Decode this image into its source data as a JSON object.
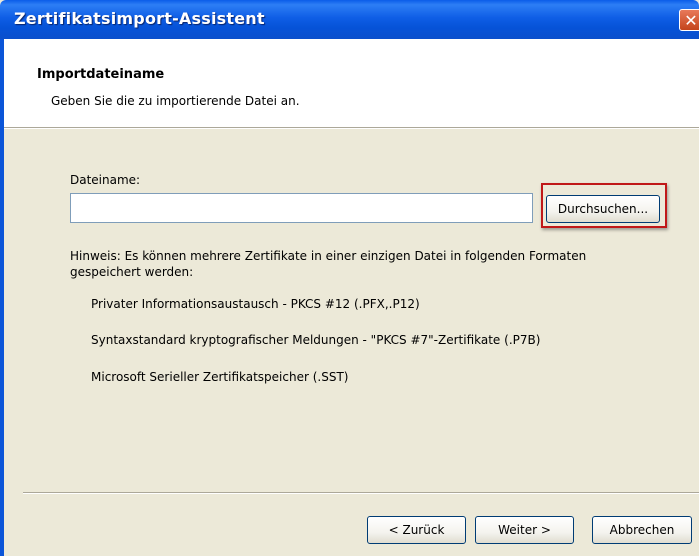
{
  "window": {
    "title": "Zertifikatsimport-Assistent",
    "close_glyph": "✕"
  },
  "header": {
    "title": "Importdateiname",
    "subtitle": "Geben Sie die zu importierende Datei an."
  },
  "form": {
    "filename_label": "Dateiname:",
    "filename_value": "",
    "browse_label": "Durchsuchen..."
  },
  "info": {
    "hint": "Hinweis: Es können mehrere Zertifikate in einer einzigen Datei in folgenden Formaten gespeichert werden:",
    "hint_line1": "Hinweis: Es können mehrere Zertifikate in einer einzigen Datei in folgenden Formaten",
    "hint_line2": "gespeichert werden:",
    "formats": [
      "Privater Informationsaustausch - PKCS #12 (.PFX,.P12)",
      "Syntaxstandard kryptografischer Meldungen - \"PKCS #7\"-Zertifikate (.P7B)",
      "Microsoft Serieller Zertifikatspeicher (.SST)"
    ]
  },
  "footer": {
    "back_label": "< Zurück",
    "next_label": "Weiter >",
    "cancel_label": "Abbrechen"
  },
  "colors": {
    "titlebar": "#0a5ce9",
    "highlight": "#c01818",
    "dialog_bg": "#ece9d8"
  }
}
